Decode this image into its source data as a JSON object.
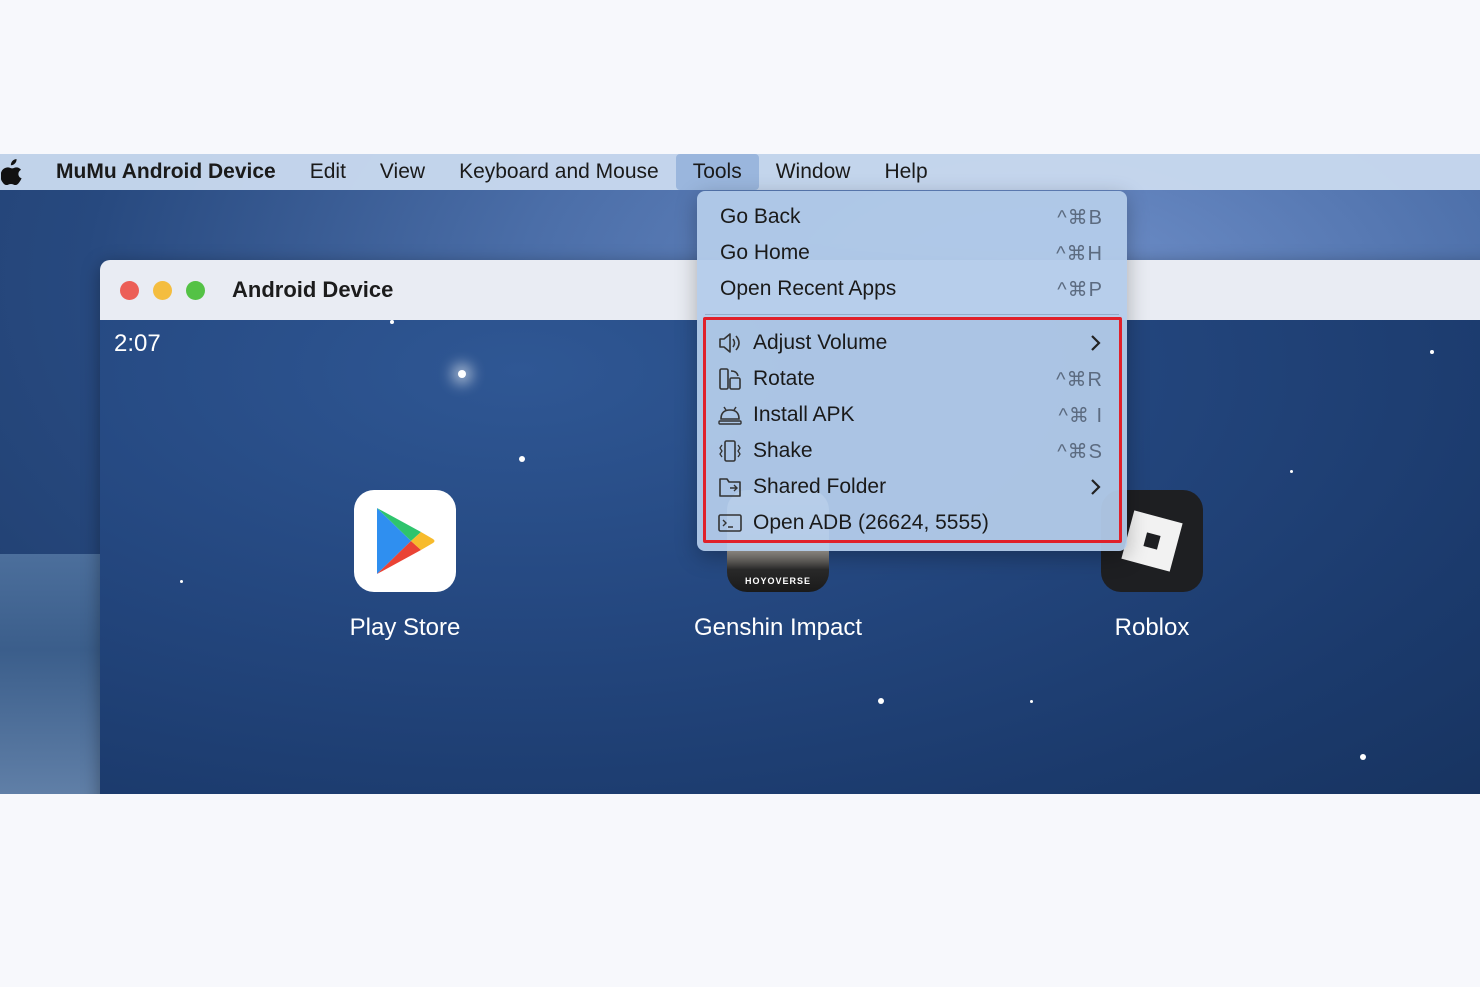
{
  "menubar": {
    "apple_icon": "apple-logo-icon",
    "app_name": "MuMu Android Device",
    "items": [
      "Edit",
      "View",
      "Keyboard and Mouse",
      "Tools",
      "Window",
      "Help"
    ],
    "active": "Tools"
  },
  "window": {
    "title": "Android Device",
    "traffic_lights": [
      "close",
      "minimize",
      "zoom"
    ]
  },
  "screen": {
    "time": "2:07",
    "apps": [
      {
        "label": "Play Store",
        "icon": "play-store-icon"
      },
      {
        "label": "Genshin Impact",
        "icon": "genshin-impact-icon",
        "badge": "HOYOVERSE"
      },
      {
        "label": "Roblox",
        "icon": "roblox-icon"
      }
    ]
  },
  "tools_menu": {
    "items": [
      {
        "label": "Go Back",
        "shortcut": "^⌘B"
      },
      {
        "label": "Go Home",
        "shortcut": "^⌘H"
      },
      {
        "label": "Open Recent Apps",
        "shortcut": "^⌘P"
      },
      {
        "label": "Adjust Volume",
        "icon": "speaker-icon",
        "submenu": true
      },
      {
        "label": "Rotate",
        "icon": "rotate-icon",
        "shortcut": "^⌘R"
      },
      {
        "label": "Install APK",
        "icon": "android-icon",
        "shortcut": "^⌘ I"
      },
      {
        "label": "Shake",
        "icon": "shake-icon",
        "shortcut": "^⌘S"
      },
      {
        "label": "Shared Folder",
        "icon": "folder-icon",
        "submenu": true
      },
      {
        "label": "Open ADB (26624, 5555)",
        "icon": "terminal-icon"
      }
    ],
    "highlight_color": "#e0202a"
  },
  "colors": {
    "menubar": "#c8d8ee",
    "desktop": "#4b6ea8",
    "android_screen": "#24477f"
  }
}
